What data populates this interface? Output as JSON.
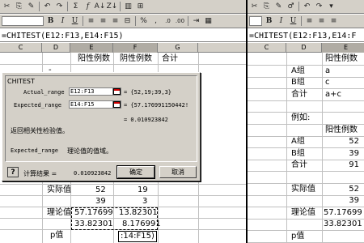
{
  "left": {
    "toolbar1": [
      "✂",
      "⎘",
      "✎",
      "↶",
      "↷",
      "Σ",
      "f",
      "A↓",
      "Z↓",
      "▥",
      "⊞"
    ],
    "toolbar2": {
      "bold": "B",
      "italic": "I",
      "underline": "U",
      "currency": "%",
      "comma": ",",
      "dec_inc": ".0",
      "dec_dec": ".00"
    },
    "formula": "=CHITEST(E12:F13,E14:F15)",
    "columns": [
      "C",
      "D",
      "E",
      "F",
      "G"
    ],
    "cells": {
      "e_hdr": "阳性例数",
      "f_hdr": "阴性例数",
      "g_hdr": "合计",
      "d_partial": "-",
      "actual_label": "实际值",
      "a1": "52",
      "a2": "19",
      "a3": "39",
      "a4": "3",
      "theory_label": "理论值",
      "t1": "57.17699",
      "t2": "13.82301",
      "t3": "33.82301",
      "t4": "8.176991",
      "p_label": "p值",
      "p_formula": ":14:F15)"
    },
    "dialog": {
      "title": "CHITEST",
      "actual_label": "Actual_range",
      "actual_value": "E12:F13",
      "actual_result": "= {52,19;39,3}",
      "expected_label": "Expected_range",
      "expected_value": "E14:F15",
      "expected_result": "= {57.17699115044​2!",
      "result_inline": "= 0.010923842",
      "description": "返回相关性检验值。",
      "param_desc_name": "Expected_range",
      "param_desc": "理论值的值域。",
      "help": "?",
      "calc_label": "计算结果 =",
      "calc_value": "0.010923842",
      "ok": "确定",
      "cancel": "取消"
    }
  },
  "right": {
    "toolbar1": [
      "✂",
      "⎘",
      "✎",
      "♂",
      "↶",
      "↷",
      "▾"
    ],
    "toolbar2": {
      "bold": "B",
      "italic": "I",
      "underline": "U"
    },
    "formula": "=CHITEST(E12:F13,E14:F",
    "columns": [
      "C",
      "D",
      "E"
    ],
    "rows": [
      {
        "d": "",
        "e": "阳性例数"
      },
      {
        "d": "A组",
        "e": "a"
      },
      {
        "d": "B组",
        "e": "c"
      },
      {
        "d": "合计",
        "e": "a+c"
      },
      {
        "d": "",
        "e": ""
      },
      {
        "d": "例如:",
        "e": ""
      },
      {
        "d": "",
        "e": "阳性例数"
      },
      {
        "d": "A组",
        "e": "52"
      },
      {
        "d": "B组",
        "e": "39"
      },
      {
        "d": "合计",
        "e": "91"
      },
      {
        "d": "",
        "e": ""
      },
      {
        "d": "实际值",
        "e": "52"
      },
      {
        "d": "",
        "e": "39"
      },
      {
        "d": "理论值",
        "e": "57.17699"
      },
      {
        "d": "",
        "e": "33.82301"
      },
      {
        "d": "p值",
        "e": ""
      }
    ]
  }
}
